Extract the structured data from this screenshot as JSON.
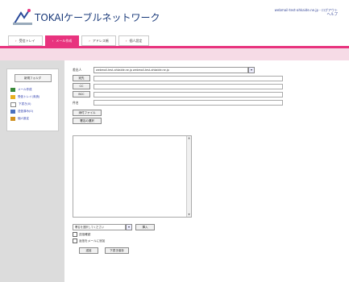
{
  "header": {
    "brand": "TOKAIケーブルネットワーク",
    "account": "webmail-test-ahkaide.ne.jp - ログアウト",
    "help": "ヘルプ"
  },
  "tabs": [
    {
      "label": "受信トレイ"
    },
    {
      "label": "メール作成"
    },
    {
      "label": "アドレス帳"
    },
    {
      "label": "個人設定"
    }
  ],
  "sidebar": {
    "button": "新規フォルダ",
    "items": [
      {
        "label": "メール作成"
      },
      {
        "label": "受信トレイ(未読)"
      },
      {
        "label": "下書き(0)"
      },
      {
        "label": "送信済み(0)"
      },
      {
        "label": "個人設定"
      }
    ]
  },
  "compose": {
    "from_label": "差出人",
    "from_value": "webmail-test-ahkaide.ne.jp webmail-test-ahkaide.ne.jp",
    "to_button": "宛先",
    "cc_button": "CC",
    "bcc_button": "BCC",
    "subject_label": "件名",
    "attach_button": "添付ファイル",
    "signature_button": "署名の選択",
    "signature_select": "署名を選択してください",
    "insert_button": "挿入",
    "option1": "送信確認",
    "option2": "返信をメールに追加",
    "send_button": "送信",
    "draft_button": "下書き保存"
  },
  "colors": {
    "accent": "#e8337e",
    "band": "#f6dbe6",
    "brand": "#1a3a7a"
  }
}
